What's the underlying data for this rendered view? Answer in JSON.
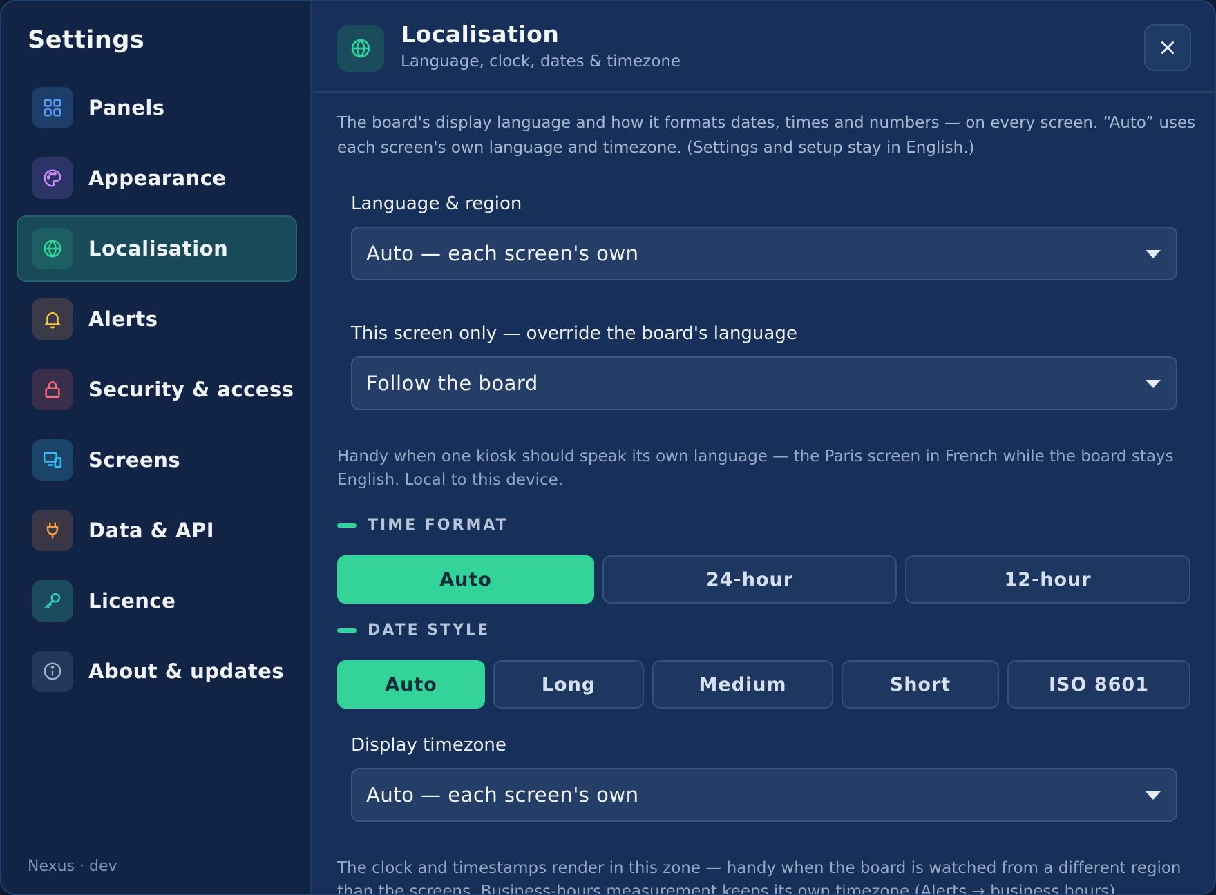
{
  "sidebar": {
    "title": "Settings",
    "footer": "Nexus · dev",
    "items": [
      {
        "label": "Panels",
        "icon": "grid-icon"
      },
      {
        "label": "Appearance",
        "icon": "palette-icon"
      },
      {
        "label": "Localisation",
        "icon": "globe-icon",
        "active": true
      },
      {
        "label": "Alerts",
        "icon": "bell-icon"
      },
      {
        "label": "Security & access",
        "icon": "lock-icon"
      },
      {
        "label": "Screens",
        "icon": "screens-icon"
      },
      {
        "label": "Data & API",
        "icon": "plug-icon"
      },
      {
        "label": "Licence",
        "icon": "key-icon"
      },
      {
        "label": "About & updates",
        "icon": "info-icon"
      }
    ]
  },
  "header": {
    "title": "Localisation",
    "subtitle": "Language, clock, dates & timezone",
    "icon": "globe-icon",
    "close_icon": "close-icon"
  },
  "content": {
    "intro": "The board's display language and how it formats dates, times and numbers — on every screen. “Auto” uses each screen's own language and timezone. (Settings and setup stay in English.)",
    "language": {
      "label": "Language & region",
      "value": "Auto — each screen's own"
    },
    "override": {
      "label": "This screen only — override the board's language",
      "value": "Follow the board",
      "hint": "Handy when one kiosk should speak its own language — the Paris screen in French while the board stays English. Local to this device."
    },
    "time_format": {
      "title": "TIME FORMAT",
      "options": [
        "Auto",
        "24-hour",
        "12-hour"
      ],
      "selected": "Auto"
    },
    "date_style": {
      "title": "DATE STYLE",
      "options": [
        "Auto",
        "Long",
        "Medium",
        "Short",
        "ISO 8601"
      ],
      "selected": "Auto"
    },
    "timezone": {
      "label": "Display timezone",
      "value": "Auto — each screen's own",
      "hint": "The clock and timestamps render in this zone — handy when the board is watched from a different region than the screens. Business-hours measurement keeps its own timezone (Alerts → business hours)."
    }
  },
  "colors": {
    "accent": "#34d399",
    "background": "#16305a",
    "sidebar": "#112446"
  }
}
